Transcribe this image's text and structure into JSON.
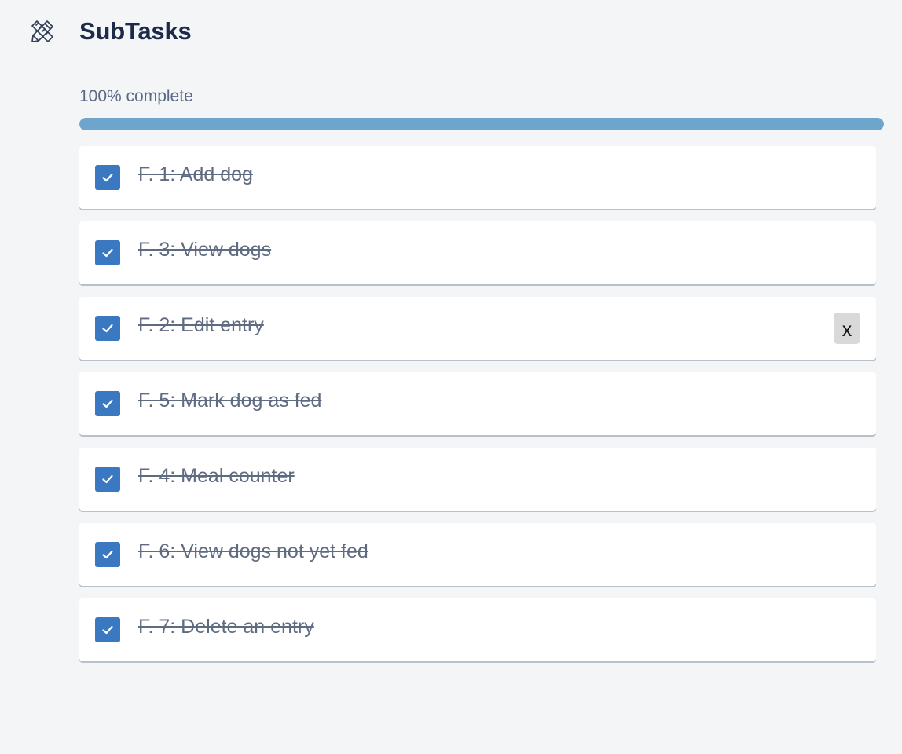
{
  "header": {
    "icon": "pencil-ruler-icon",
    "title": "SubTasks"
  },
  "progress": {
    "label": "100% complete",
    "percent": 100
  },
  "colors": {
    "checkbox": "#3a78c2",
    "progress_fill": "#6ea5cc",
    "title": "#1c2b4a",
    "task_text": "#5e6b80"
  },
  "tasks": [
    {
      "label": "F. 1: Add dog",
      "checked": true
    },
    {
      "label": "F. 3: View dogs",
      "checked": true
    },
    {
      "label": "F. 2: Edit entry",
      "checked": true,
      "delete_label": "x"
    },
    {
      "label": "F. 5: Mark dog as fed",
      "checked": true
    },
    {
      "label": "F. 4: Meal counter",
      "checked": true
    },
    {
      "label": "F. 6: View dogs not yet fed",
      "checked": true
    },
    {
      "label": "F. 7: Delete an entry",
      "checked": true
    }
  ]
}
